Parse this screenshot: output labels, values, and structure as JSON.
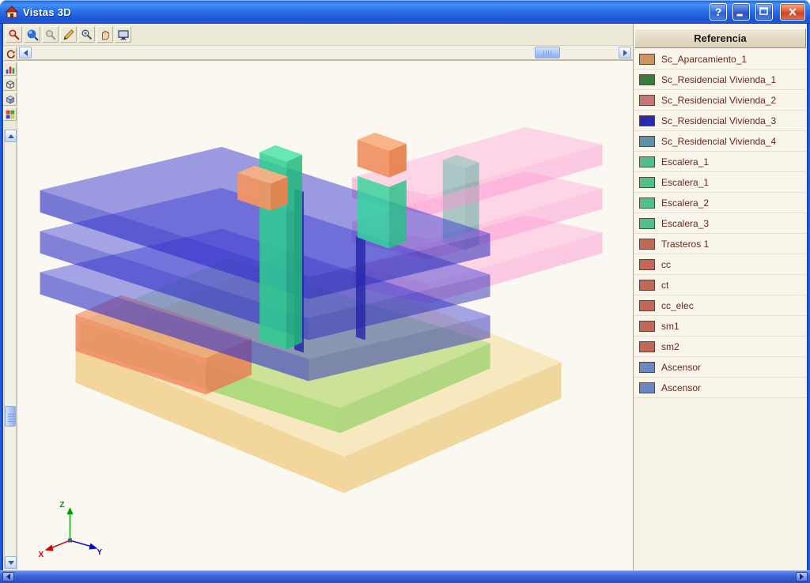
{
  "window": {
    "title": "Vistas 3D",
    "help_label": "?"
  },
  "toolbar_top": {
    "icons": [
      "zoom-all",
      "zoom-window",
      "zoom-previous",
      "measure",
      "zoom",
      "pan",
      "snapshot"
    ]
  },
  "toolbar_left": {
    "icons": [
      "rotate-view",
      "floor-bars",
      "wireframe-cube",
      "solid-cube",
      "color-render"
    ]
  },
  "legend": {
    "title": "Referencia",
    "text_color": "#70241C",
    "items": [
      {
        "label": "Sc_Aparcamiento_1",
        "color": "#CE9560"
      },
      {
        "label": "Sc_Residencial Vivienda_1",
        "color": "#3C7A40"
      },
      {
        "label": "Sc_Residencial Vivienda_2",
        "color": "#C27876"
      },
      {
        "label": "Sc_Residencial Vivienda_3",
        "color": "#2A2AB0"
      },
      {
        "label": "Sc_Residencial Vivienda_4",
        "color": "#5C92AA"
      },
      {
        "label": "Escalera_1",
        "color": "#52BE88"
      },
      {
        "label": "Escalera_1",
        "color": "#52BE88"
      },
      {
        "label": "Escalera_2",
        "color": "#52BE88"
      },
      {
        "label": "Escalera_3",
        "color": "#52BE88"
      },
      {
        "label": "Trasteros 1",
        "color": "#C2685A"
      },
      {
        "label": "cc",
        "color": "#C2685A"
      },
      {
        "label": "ct",
        "color": "#C2685A"
      },
      {
        "label": "cc_elec",
        "color": "#C2685A"
      },
      {
        "label": "sm1",
        "color": "#C2685A"
      },
      {
        "label": "sm2",
        "color": "#C2685A"
      },
      {
        "label": "Ascensor",
        "color": "#6888C4"
      },
      {
        "label": "Ascensor",
        "color": "#6888C4"
      }
    ]
  },
  "axes": {
    "x_label": "X",
    "y_label": "Y",
    "z_label": "Z",
    "x_color": "#D40000",
    "y_color": "#0000D4",
    "z_color": "#009A00"
  }
}
